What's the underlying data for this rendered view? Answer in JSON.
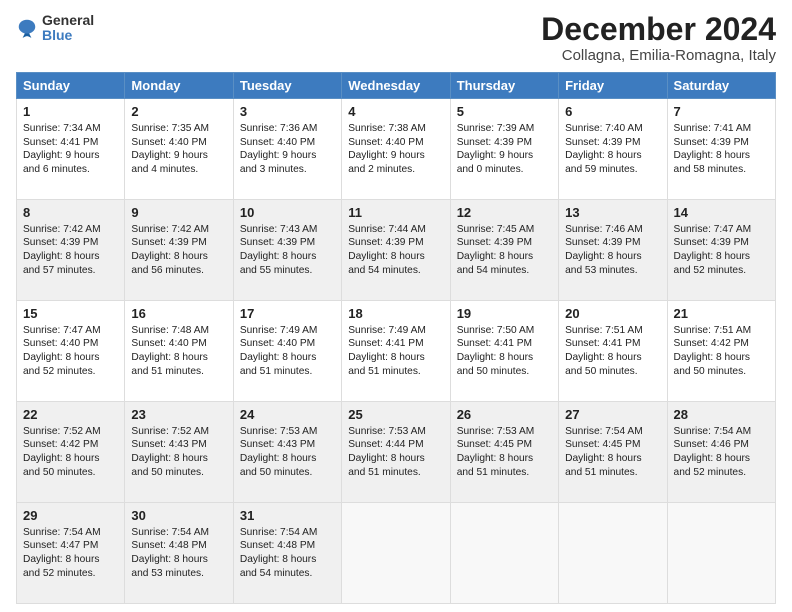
{
  "header": {
    "logo_line1": "General",
    "logo_line2": "Blue",
    "month_title": "December 2024",
    "subtitle": "Collagna, Emilia-Romagna, Italy"
  },
  "days_of_week": [
    "Sunday",
    "Monday",
    "Tuesday",
    "Wednesday",
    "Thursday",
    "Friday",
    "Saturday"
  ],
  "weeks": [
    [
      {
        "day": "1",
        "sunrise": "Sunrise: 7:34 AM",
        "sunset": "Sunset: 4:41 PM",
        "daylight": "Daylight: 9 hours and 6 minutes."
      },
      {
        "day": "2",
        "sunrise": "Sunrise: 7:35 AM",
        "sunset": "Sunset: 4:40 PM",
        "daylight": "Daylight: 9 hours and 4 minutes."
      },
      {
        "day": "3",
        "sunrise": "Sunrise: 7:36 AM",
        "sunset": "Sunset: 4:40 PM",
        "daylight": "Daylight: 9 hours and 3 minutes."
      },
      {
        "day": "4",
        "sunrise": "Sunrise: 7:38 AM",
        "sunset": "Sunset: 4:40 PM",
        "daylight": "Daylight: 9 hours and 2 minutes."
      },
      {
        "day": "5",
        "sunrise": "Sunrise: 7:39 AM",
        "sunset": "Sunset: 4:39 PM",
        "daylight": "Daylight: 9 hours and 0 minutes."
      },
      {
        "day": "6",
        "sunrise": "Sunrise: 7:40 AM",
        "sunset": "Sunset: 4:39 PM",
        "daylight": "Daylight: 8 hours and 59 minutes."
      },
      {
        "day": "7",
        "sunrise": "Sunrise: 7:41 AM",
        "sunset": "Sunset: 4:39 PM",
        "daylight": "Daylight: 8 hours and 58 minutes."
      }
    ],
    [
      {
        "day": "8",
        "sunrise": "Sunrise: 7:42 AM",
        "sunset": "Sunset: 4:39 PM",
        "daylight": "Daylight: 8 hours and 57 minutes."
      },
      {
        "day": "9",
        "sunrise": "Sunrise: 7:42 AM",
        "sunset": "Sunset: 4:39 PM",
        "daylight": "Daylight: 8 hours and 56 minutes."
      },
      {
        "day": "10",
        "sunrise": "Sunrise: 7:43 AM",
        "sunset": "Sunset: 4:39 PM",
        "daylight": "Daylight: 8 hours and 55 minutes."
      },
      {
        "day": "11",
        "sunrise": "Sunrise: 7:44 AM",
        "sunset": "Sunset: 4:39 PM",
        "daylight": "Daylight: 8 hours and 54 minutes."
      },
      {
        "day": "12",
        "sunrise": "Sunrise: 7:45 AM",
        "sunset": "Sunset: 4:39 PM",
        "daylight": "Daylight: 8 hours and 54 minutes."
      },
      {
        "day": "13",
        "sunrise": "Sunrise: 7:46 AM",
        "sunset": "Sunset: 4:39 PM",
        "daylight": "Daylight: 8 hours and 53 minutes."
      },
      {
        "day": "14",
        "sunrise": "Sunrise: 7:47 AM",
        "sunset": "Sunset: 4:39 PM",
        "daylight": "Daylight: 8 hours and 52 minutes."
      }
    ],
    [
      {
        "day": "15",
        "sunrise": "Sunrise: 7:47 AM",
        "sunset": "Sunset: 4:40 PM",
        "daylight": "Daylight: 8 hours and 52 minutes."
      },
      {
        "day": "16",
        "sunrise": "Sunrise: 7:48 AM",
        "sunset": "Sunset: 4:40 PM",
        "daylight": "Daylight: 8 hours and 51 minutes."
      },
      {
        "day": "17",
        "sunrise": "Sunrise: 7:49 AM",
        "sunset": "Sunset: 4:40 PM",
        "daylight": "Daylight: 8 hours and 51 minutes."
      },
      {
        "day": "18",
        "sunrise": "Sunrise: 7:49 AM",
        "sunset": "Sunset: 4:41 PM",
        "daylight": "Daylight: 8 hours and 51 minutes."
      },
      {
        "day": "19",
        "sunrise": "Sunrise: 7:50 AM",
        "sunset": "Sunset: 4:41 PM",
        "daylight": "Daylight: 8 hours and 50 minutes."
      },
      {
        "day": "20",
        "sunrise": "Sunrise: 7:51 AM",
        "sunset": "Sunset: 4:41 PM",
        "daylight": "Daylight: 8 hours and 50 minutes."
      },
      {
        "day": "21",
        "sunrise": "Sunrise: 7:51 AM",
        "sunset": "Sunset: 4:42 PM",
        "daylight": "Daylight: 8 hours and 50 minutes."
      }
    ],
    [
      {
        "day": "22",
        "sunrise": "Sunrise: 7:52 AM",
        "sunset": "Sunset: 4:42 PM",
        "daylight": "Daylight: 8 hours and 50 minutes."
      },
      {
        "day": "23",
        "sunrise": "Sunrise: 7:52 AM",
        "sunset": "Sunset: 4:43 PM",
        "daylight": "Daylight: 8 hours and 50 minutes."
      },
      {
        "day": "24",
        "sunrise": "Sunrise: 7:53 AM",
        "sunset": "Sunset: 4:43 PM",
        "daylight": "Daylight: 8 hours and 50 minutes."
      },
      {
        "day": "25",
        "sunrise": "Sunrise: 7:53 AM",
        "sunset": "Sunset: 4:44 PM",
        "daylight": "Daylight: 8 hours and 51 minutes."
      },
      {
        "day": "26",
        "sunrise": "Sunrise: 7:53 AM",
        "sunset": "Sunset: 4:45 PM",
        "daylight": "Daylight: 8 hours and 51 minutes."
      },
      {
        "day": "27",
        "sunrise": "Sunrise: 7:54 AM",
        "sunset": "Sunset: 4:45 PM",
        "daylight": "Daylight: 8 hours and 51 minutes."
      },
      {
        "day": "28",
        "sunrise": "Sunrise: 7:54 AM",
        "sunset": "Sunset: 4:46 PM",
        "daylight": "Daylight: 8 hours and 52 minutes."
      }
    ],
    [
      {
        "day": "29",
        "sunrise": "Sunrise: 7:54 AM",
        "sunset": "Sunset: 4:47 PM",
        "daylight": "Daylight: 8 hours and 52 minutes."
      },
      {
        "day": "30",
        "sunrise": "Sunrise: 7:54 AM",
        "sunset": "Sunset: 4:48 PM",
        "daylight": "Daylight: 8 hours and 53 minutes."
      },
      {
        "day": "31",
        "sunrise": "Sunrise: 7:54 AM",
        "sunset": "Sunset: 4:48 PM",
        "daylight": "Daylight: 8 hours and 54 minutes."
      },
      null,
      null,
      null,
      null
    ]
  ]
}
